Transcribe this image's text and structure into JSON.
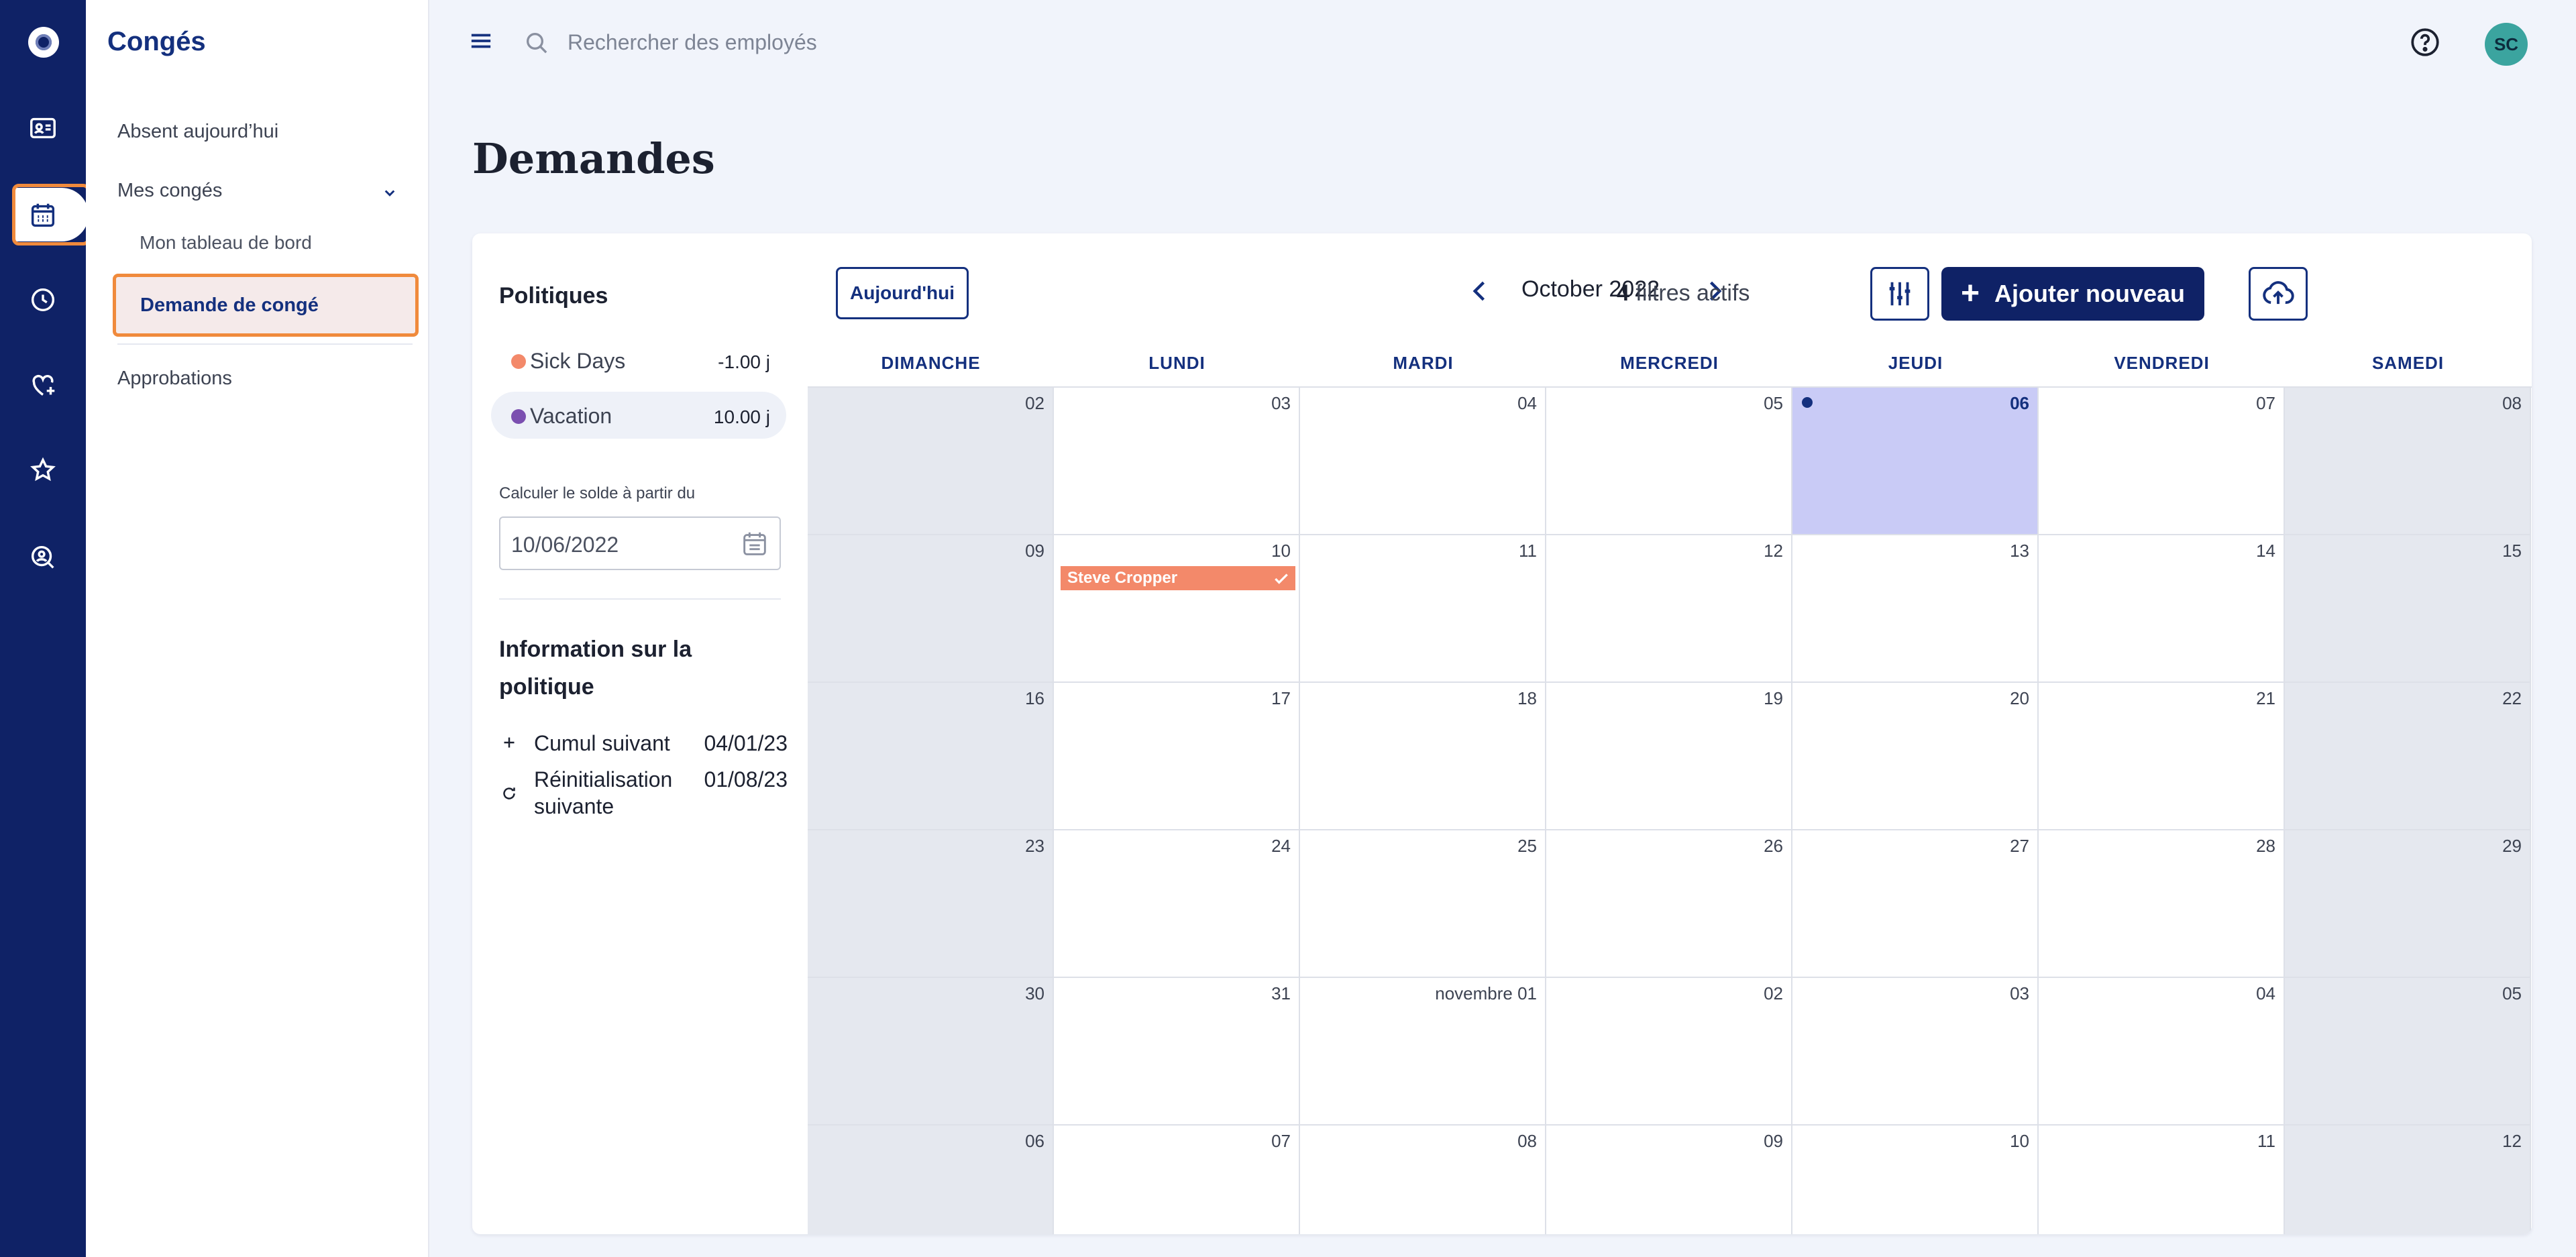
{
  "app": {
    "module_title": "Congés"
  },
  "rail": {
    "items": [
      {
        "icon": "logo-icon"
      },
      {
        "icon": "id-card-icon"
      },
      {
        "icon": "calendar-icon",
        "active": true
      },
      {
        "icon": "clock-icon"
      },
      {
        "icon": "heart-plus-icon"
      },
      {
        "icon": "star-badge-icon"
      },
      {
        "icon": "person-search-icon"
      }
    ]
  },
  "subnav": {
    "absent_today": "Absent aujourd’hui",
    "my_leaves": "Mes congés",
    "my_dashboard": "Mon tableau de bord",
    "leave_request": "Demande de congé",
    "approvals": "Approbations"
  },
  "topbar": {
    "search_placeholder": "Rechercher des employés",
    "avatar_initials": "SC"
  },
  "page": {
    "title": "Demandes"
  },
  "policies": {
    "heading": "Politiques",
    "items": [
      {
        "name": "Sick Days",
        "value": "-1.00 j",
        "color": "#f3896a"
      },
      {
        "name": "Vacation",
        "value": "10.00 j",
        "color": "#7b4fb0"
      }
    ],
    "calc_label": "Calculer le solde à partir du",
    "calc_date": "10/06/2022",
    "info_heading": "Information sur la politique",
    "info": [
      {
        "label": "Cumul suivant",
        "date": "04/01/23"
      },
      {
        "label": "Réinitialisation suivante",
        "date": "01/08/23"
      }
    ]
  },
  "calendar": {
    "today_button": "Aujourd'hui",
    "month": "October 2022",
    "filters_count": "4",
    "filters_text": "filtres actifs",
    "add_button": "Ajouter nouveau",
    "weekdays": [
      "DIMANCHE",
      "LUNDI",
      "MARDI",
      "MERCREDI",
      "JEUDI",
      "VENDREDI",
      "SAMEDI"
    ],
    "weeks": [
      [
        "02",
        "03",
        "04",
        "05",
        "06",
        "07",
        "08"
      ],
      [
        "09",
        "10",
        "11",
        "12",
        "13",
        "14",
        "15"
      ],
      [
        "16",
        "17",
        "18",
        "19",
        "20",
        "21",
        "22"
      ],
      [
        "23",
        "24",
        "25",
        "26",
        "27",
        "28",
        "29"
      ],
      [
        "30",
        "31",
        "novembre 01",
        "02",
        "03",
        "04",
        "05"
      ],
      [
        "06",
        "07",
        "08",
        "09",
        "10",
        "11",
        "12"
      ]
    ],
    "today": {
      "week": 0,
      "day": 4
    },
    "events": [
      {
        "week": 1,
        "day": 1,
        "label": "Steve Cropper",
        "approved": true,
        "color": "#f3896a"
      }
    ],
    "colors": {
      "weekend": "#e5e8ef",
      "today": "#c9cbf6",
      "accent": "#0f2266"
    }
  }
}
